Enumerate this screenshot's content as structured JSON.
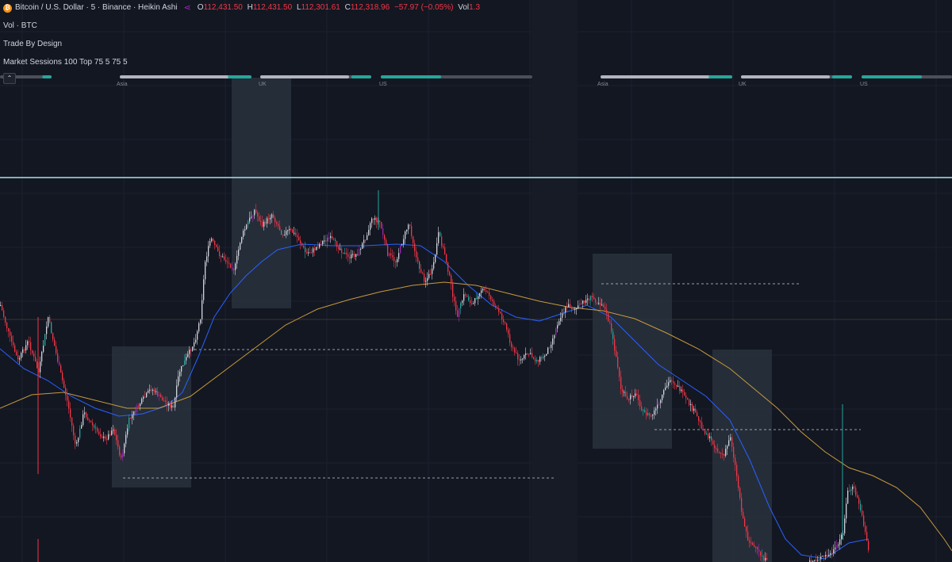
{
  "header": {
    "symbol_title": "Bitcoin / U.S. Dollar · 5 · Binance · Heikin Ashi",
    "coin_glyph": "₿",
    "ohlc": {
      "o_label": "O",
      "o": "112,431.50",
      "h_label": "H",
      "h": "112,431.50",
      "l_label": "L",
      "l": "112,301.61",
      "c_label": "C",
      "c": "112,318.96",
      "change": "−57.97 (−0.05%)",
      "vol_label": "Vol",
      "vol": "1.3"
    }
  },
  "indicators": {
    "volume": "Vol · BTC",
    "trade_by_design": "Trade By Design",
    "market_sessions": "Market Sessions 100 Top 75 5 75 5",
    "collapse_glyph": "⌃"
  },
  "sessions": {
    "left_group": [
      "Asia",
      "UK",
      "US"
    ],
    "right_group": [
      "Asia",
      "UK",
      "US"
    ]
  },
  "colors": {
    "background": "#131722",
    "up_candle": "#d1d4dc",
    "down_candle": "#f23645",
    "green_candle": "#26a69a",
    "purple_candle": "#9c27b0",
    "ma_fast": "#2962ff",
    "ma_slow": "#c79a3c",
    "session_box": "#2a3340",
    "session_bar_accent": "#26a69a",
    "resistance_line": "#a7e3e8",
    "coin_orange": "#f7931a"
  },
  "chart_data": {
    "type": "candlestick",
    "style": "Heikin Ashi",
    "timeframe": "5",
    "moving_averages": [
      "fast MA (blue)",
      "slow MA (orange)"
    ],
    "grid": true
  }
}
